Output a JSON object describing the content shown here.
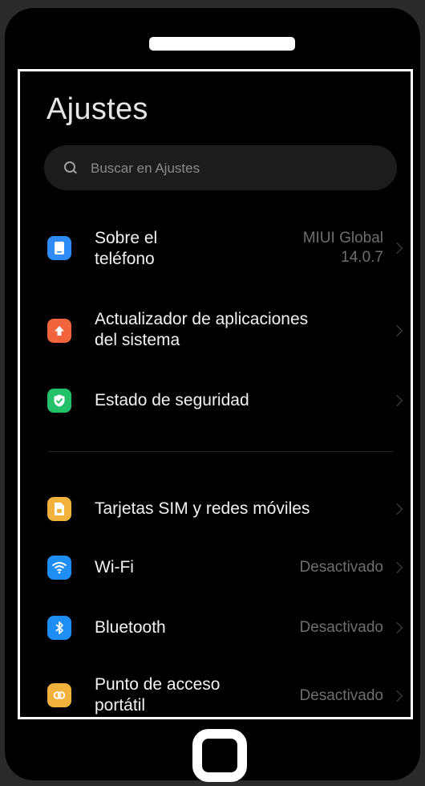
{
  "header": {
    "title": "Ajustes"
  },
  "search": {
    "placeholder": "Buscar en Ajustes"
  },
  "items": [
    {
      "label_line1": "Sobre el",
      "label_line2": "teléfono",
      "value_line1": "MIUI Global",
      "value_line2": "14.0.7",
      "icon": "phone-icon",
      "color": "#2f8cf6"
    },
    {
      "label_line1": "Actualizador de aplicaciones",
      "label_line2": "del sistema",
      "icon": "arrow-up-icon",
      "color": "#f2643c"
    },
    {
      "label": "Estado de seguridad",
      "icon": "shield-check-icon",
      "color": "#23c26a"
    },
    {
      "label": "Tarjetas SIM y redes móviles",
      "icon": "sim-card-icon",
      "color": "#f3b23c"
    },
    {
      "label": "Wi-Fi",
      "value": "Desactivado",
      "icon": "wifi-icon",
      "color": "#1e8ef5"
    },
    {
      "label": "Bluetooth",
      "value": "Desactivado",
      "icon": "bluetooth-icon",
      "color": "#1e8ef5"
    },
    {
      "label_line1": "Punto de acceso",
      "label_line2": "portátil",
      "value": "Desactivado",
      "icon": "hotspot-icon",
      "color": "#f3b23c"
    }
  ]
}
